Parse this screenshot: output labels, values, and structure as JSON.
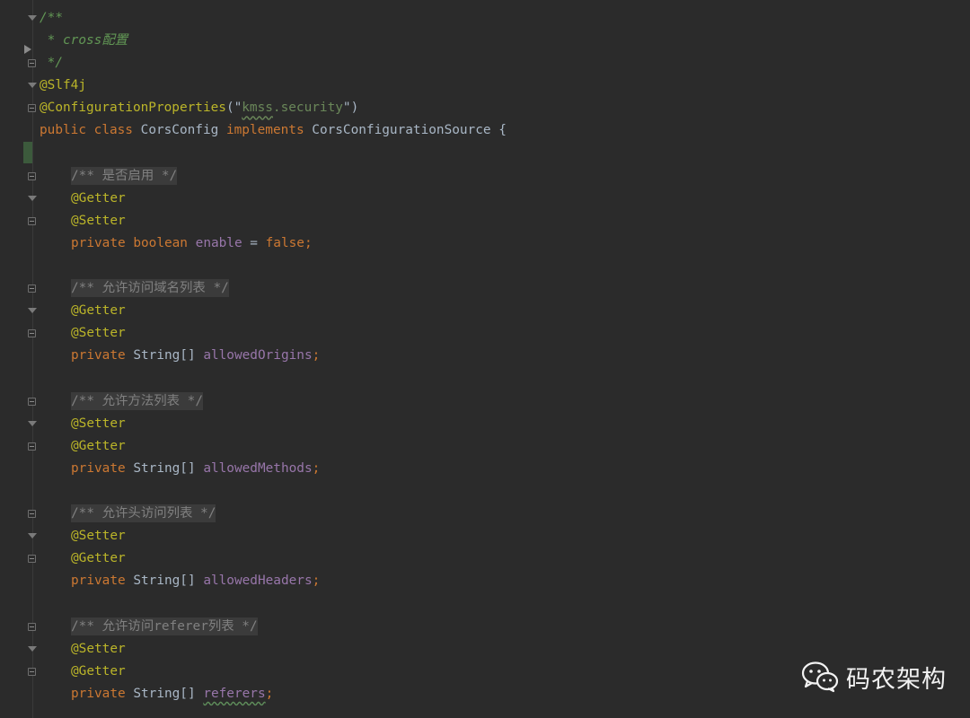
{
  "editor": {
    "lines": [
      {
        "kind": "doc_open",
        "text": "/**"
      },
      {
        "kind": "doc_line",
        "prefix": " * ",
        "text": "cross配置"
      },
      {
        "kind": "doc_close",
        "text": " */"
      },
      {
        "kind": "annotation",
        "text": "@Slf4j"
      },
      {
        "kind": "annotation_arg",
        "annotation": "@ConfigurationProperties",
        "open": "(\"",
        "squiggle": "kmss",
        "rest": ".security",
        "close": "\")"
      },
      {
        "kind": "class_decl",
        "public": "public",
        "class": "class",
        "name": "CorsConfig",
        "implements": "implements",
        "iface": "CorsConfigurationSource",
        "brace": "{"
      },
      {
        "kind": "blank",
        "text": ""
      },
      {
        "kind": "comment",
        "text": "/** 是否启用 */"
      },
      {
        "kind": "annotation",
        "text": "@Getter"
      },
      {
        "kind": "annotation",
        "text": "@Setter"
      },
      {
        "kind": "field_bool",
        "mod": "private",
        "type": "boolean",
        "name": "enable",
        "eq": " = ",
        "value": "false",
        "end": ";"
      },
      {
        "kind": "blank",
        "text": ""
      },
      {
        "kind": "comment",
        "text": "/** 允许访问域名列表 */"
      },
      {
        "kind": "annotation",
        "text": "@Getter"
      },
      {
        "kind": "annotation",
        "text": "@Setter"
      },
      {
        "kind": "field",
        "mod": "private",
        "type": "String[]",
        "name": "allowedOrigins",
        "end": ";"
      },
      {
        "kind": "blank",
        "text": ""
      },
      {
        "kind": "comment",
        "text": "/** 允许方法列表 */"
      },
      {
        "kind": "annotation",
        "text": "@Setter"
      },
      {
        "kind": "annotation",
        "text": "@Getter"
      },
      {
        "kind": "field",
        "mod": "private",
        "type": "String[]",
        "name": "allowedMethods",
        "end": ";"
      },
      {
        "kind": "blank",
        "text": ""
      },
      {
        "kind": "comment",
        "text": "/** 允许头访问列表 */"
      },
      {
        "kind": "annotation",
        "text": "@Setter"
      },
      {
        "kind": "annotation",
        "text": "@Getter"
      },
      {
        "kind": "field",
        "mod": "private",
        "type": "String[]",
        "name": "allowedHeaders",
        "end": ";"
      },
      {
        "kind": "blank",
        "text": ""
      },
      {
        "kind": "comment",
        "text": "/** 允许访问referer列表 */"
      },
      {
        "kind": "annotation",
        "text": "@Setter"
      },
      {
        "kind": "annotation",
        "text": "@Getter"
      },
      {
        "kind": "field",
        "mod": "private",
        "type": "String[]",
        "name": "referers",
        "end": ";",
        "squiggle": true
      }
    ]
  },
  "watermark": {
    "text": "码农架构",
    "icon": "wechat-icon"
  },
  "colors": {
    "background": "#2b2b2b",
    "keyword": "#cc7832",
    "annotation": "#bbb529",
    "field": "#9876aa",
    "string": "#6a8759",
    "doc_comment": "#629755",
    "block_comment": "#808080",
    "text": "#a9b7c6"
  }
}
